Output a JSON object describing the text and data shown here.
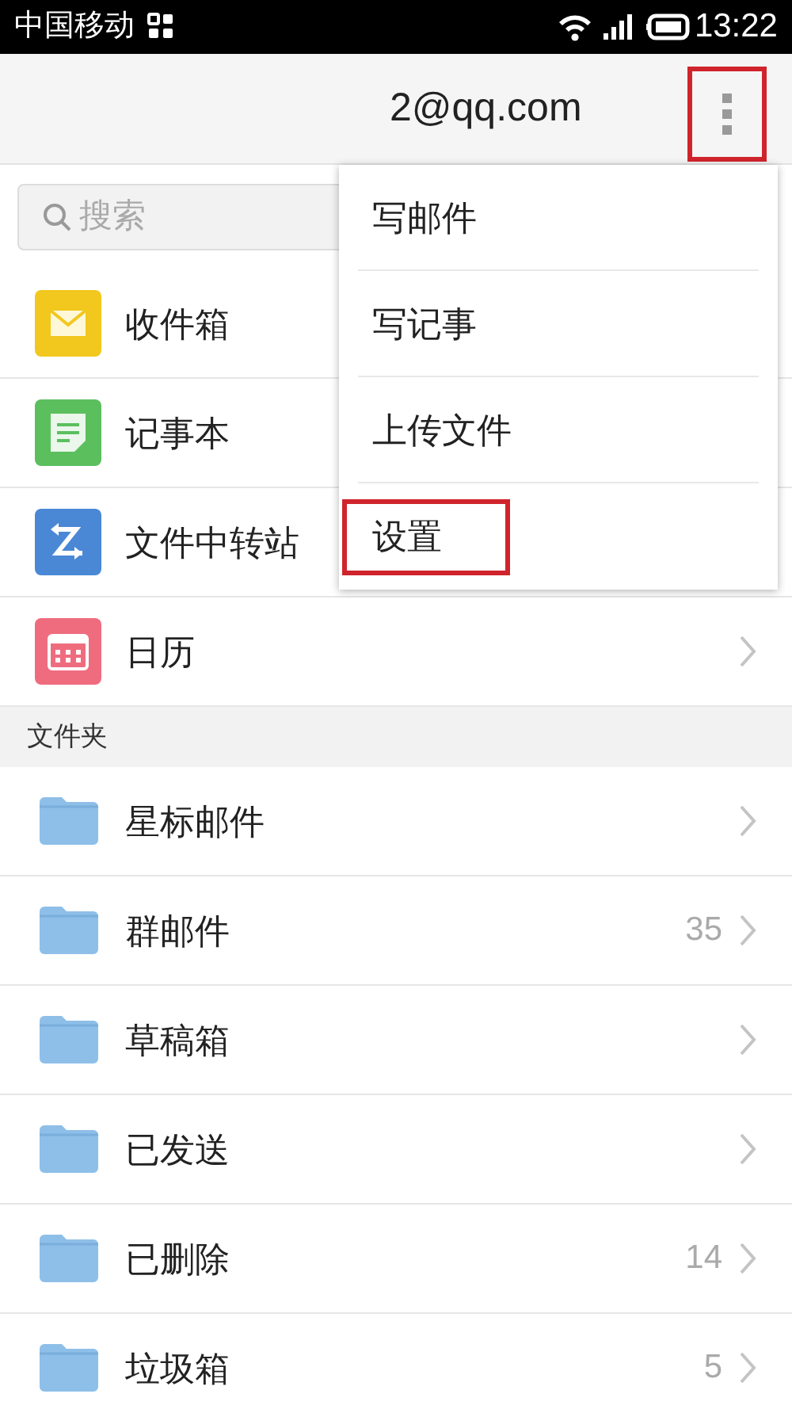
{
  "status_bar": {
    "carrier": "中国移动",
    "time": "13:22"
  },
  "header": {
    "account": "2@qq.com",
    "more_button": {
      "highlighted": true
    }
  },
  "search": {
    "placeholder": "搜索"
  },
  "apps": [
    {
      "label": "收件箱",
      "kind": "mail",
      "color": "#f2c71e"
    },
    {
      "label": "记事本",
      "kind": "note",
      "color": "#5bbf5e"
    },
    {
      "label": "文件中转站",
      "kind": "transfer",
      "color": "#4a88d6"
    },
    {
      "label": "日历",
      "kind": "calendar",
      "color": "#ef6c7f"
    }
  ],
  "folders_section": {
    "title": "文件夹",
    "items": [
      {
        "label": "星标邮件"
      },
      {
        "label": "群邮件",
        "count": "35"
      },
      {
        "label": "草稿箱"
      },
      {
        "label": "已发送"
      },
      {
        "label": "已删除",
        "count": "14"
      },
      {
        "label": "垃圾箱",
        "count": "5"
      }
    ]
  },
  "menu": {
    "items": [
      {
        "label": "写邮件",
        "highlighted": false
      },
      {
        "label": "写记事",
        "highlighted": false
      },
      {
        "label": "上传文件",
        "highlighted": false
      },
      {
        "label": "设置",
        "highlighted": true
      }
    ]
  }
}
